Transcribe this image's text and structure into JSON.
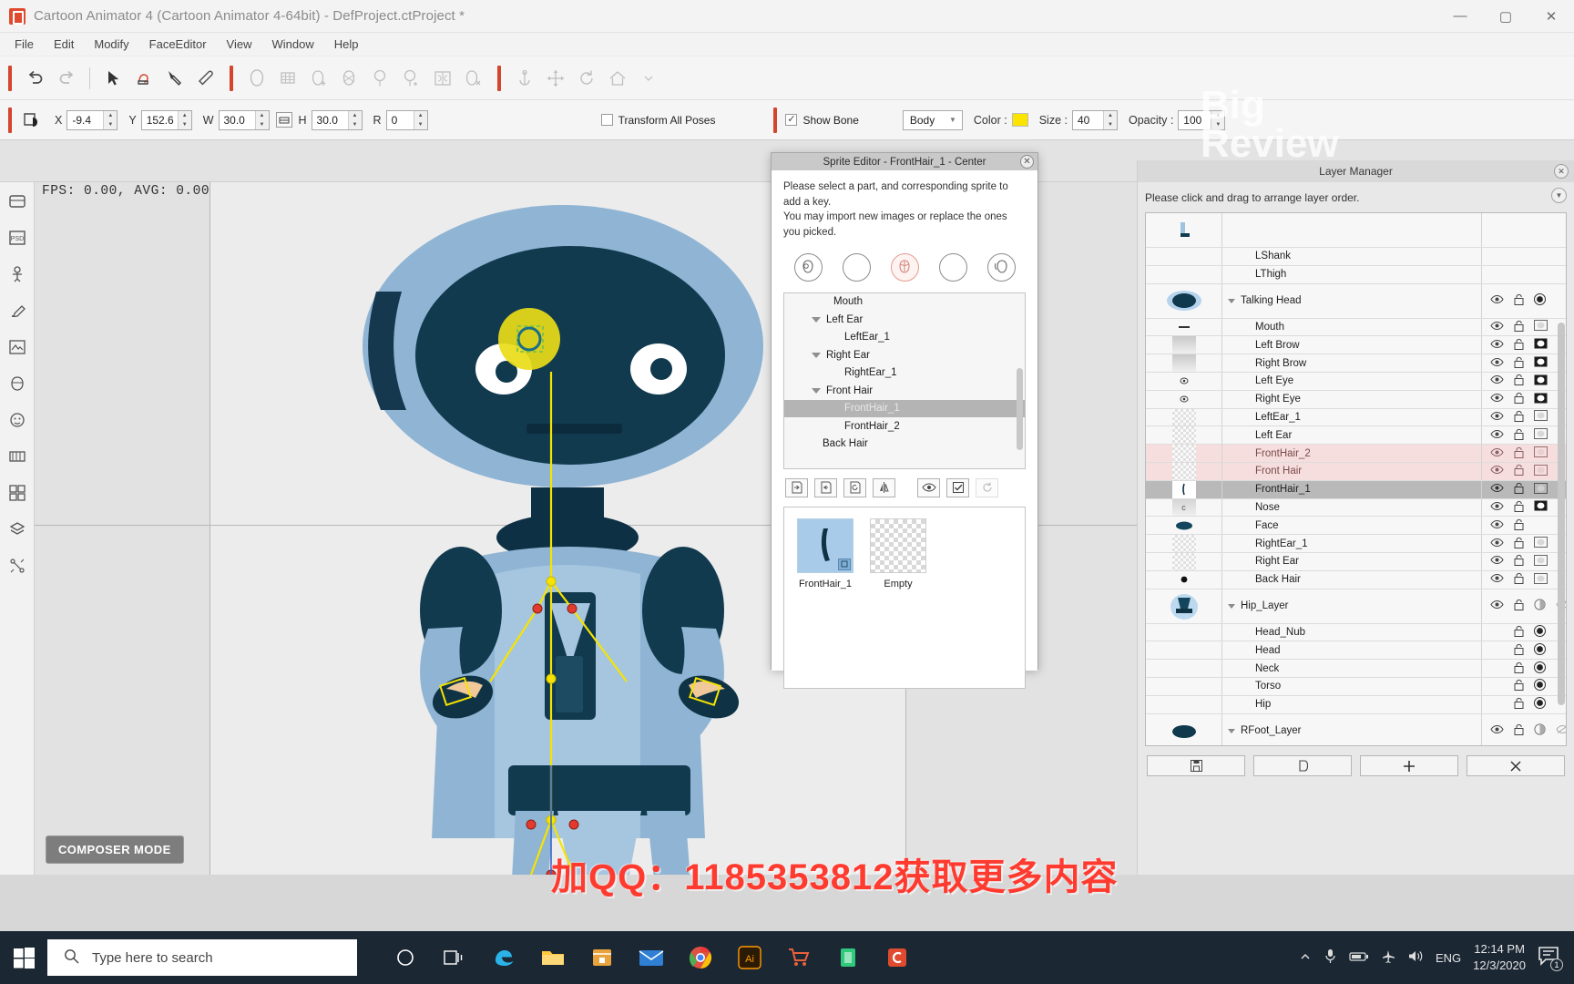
{
  "window": {
    "title": "Cartoon Animator 4  (Cartoon Animator 4-64bit) - DefProject.ctProject *",
    "minimize": "—",
    "maximize": "▢",
    "close": "✕"
  },
  "menu": [
    "File",
    "Edit",
    "Modify",
    "FaceEditor",
    "View",
    "Window",
    "Help"
  ],
  "toolbar": {
    "icons": [
      "undo-icon",
      "redo-icon",
      "select-arrow-icon",
      "hand-sprite-icon",
      "pen-tool-icon",
      "eraser-icon",
      "head-icon",
      "grid-head-icon",
      "head-add-icon",
      "head-bone-icon",
      "head-spring-icon",
      "head-spring-add-icon",
      "mirror-head-icon",
      "head-delete-icon",
      "anchor-icon",
      "move-icon",
      "rotate-icon",
      "home-icon"
    ]
  },
  "properties": {
    "x_label": "X",
    "x_value": "-9.4",
    "y_label": "Y",
    "y_value": "152.6",
    "w_label": "W",
    "w_value": "30.0",
    "h_label": "H",
    "h_value": "30.0",
    "r_label": "R",
    "r_value": "0",
    "link_icon": "link-wh-icon",
    "transform_all_poses": "Transform All Poses",
    "transform_all_poses_checked": false,
    "show_bone": "Show Bone",
    "show_bone_checked": true,
    "bone_mode": "Body",
    "color_label": "Color :",
    "color_value": "#fbe400",
    "size_label": "Size :",
    "size_value": "40",
    "opacity_label": "Opacity :",
    "opacity_value": "100"
  },
  "canvas": {
    "fps_text": "FPS: 0.00, AVG: 0.00",
    "mode_badge": "COMPOSER MODE"
  },
  "sprite_editor": {
    "title": "Sprite Editor - FrontHair_1 - Center",
    "close": "✕",
    "description_line1": "Please select a part, and corresponding sprite to add a key.",
    "description_line2": "You may import new images or replace the ones you picked.",
    "part_icons": [
      "head-pivot-icon",
      "blank-circle-icon",
      "hair-part-icon",
      "blank-circle-icon",
      "head-rotate-icon"
    ],
    "active_part_index": 2,
    "tree": [
      {
        "label": "Mouth",
        "depth": 1,
        "expandable": false,
        "selected": false
      },
      {
        "label": "Left Ear",
        "depth": 0,
        "expandable": true,
        "selected": false
      },
      {
        "label": "LeftEar_1",
        "depth": 2,
        "expandable": false,
        "selected": false
      },
      {
        "label": "Right Ear",
        "depth": 0,
        "expandable": true,
        "selected": false
      },
      {
        "label": "RightEar_1",
        "depth": 2,
        "expandable": false,
        "selected": false
      },
      {
        "label": "Front Hair",
        "depth": 0,
        "expandable": true,
        "selected": false
      },
      {
        "label": "FrontHair_1",
        "depth": 2,
        "expandable": false,
        "selected": true
      },
      {
        "label": "FrontHair_2",
        "depth": 2,
        "expandable": false,
        "selected": false
      },
      {
        "label": "Back Hair",
        "depth": 1,
        "expandable": false,
        "selected": false
      }
    ],
    "tool_icons": [
      "import-image-icon",
      "replace-image-icon",
      "reload-image-icon",
      "mirror-icon",
      "eye-icon",
      "checkbox-icon",
      "refresh-icon"
    ],
    "sprites": [
      {
        "label": "FrontHair_1",
        "selected": true,
        "empty": false
      },
      {
        "label": "Empty",
        "selected": false,
        "empty": true
      }
    ]
  },
  "layer_manager": {
    "title": "Layer Manager",
    "instruction": "Please click and drag to arrange layer order.",
    "collapse_icon": "close-icon",
    "rollup_icon": "chevron-down-icon",
    "rows": [
      {
        "name": "",
        "thumb": "foot",
        "indent": 0,
        "state": "normal",
        "big": true,
        "eye": false,
        "lock": false,
        "mask": "none"
      },
      {
        "name": "LShank",
        "thumb": "none",
        "indent": 2,
        "state": "normal",
        "big": false,
        "eye": false,
        "lock": false,
        "mask": "none"
      },
      {
        "name": "LThigh",
        "thumb": "none",
        "indent": 2,
        "state": "normal",
        "big": false,
        "eye": false,
        "lock": false,
        "mask": "none"
      },
      {
        "name": "Talking Head",
        "thumb": "head",
        "indent": 0,
        "state": "normal",
        "big": true,
        "expandable": true,
        "eye": true,
        "lock": true,
        "mask": "dot"
      },
      {
        "name": "Mouth",
        "thumb": "mouth",
        "indent": 2,
        "state": "normal",
        "big": false,
        "eye": true,
        "lock": true,
        "mask": "light"
      },
      {
        "name": "Left Brow",
        "thumb": "brow",
        "indent": 2,
        "state": "normal",
        "big": false,
        "eye": true,
        "lock": true,
        "mask": "solid"
      },
      {
        "name": "Right Brow",
        "thumb": "brow",
        "indent": 2,
        "state": "normal",
        "big": false,
        "eye": true,
        "lock": true,
        "mask": "solid"
      },
      {
        "name": "Left Eye",
        "thumb": "eye",
        "indent": 2,
        "state": "normal",
        "big": false,
        "eye": true,
        "lock": true,
        "mask": "solid"
      },
      {
        "name": "Right Eye",
        "thumb": "eye",
        "indent": 2,
        "state": "normal",
        "big": false,
        "eye": true,
        "lock": true,
        "mask": "solid"
      },
      {
        "name": "LeftEar_1",
        "thumb": "checker",
        "indent": 2,
        "state": "normal",
        "big": false,
        "eye": true,
        "lock": true,
        "mask": "light"
      },
      {
        "name": "Left Ear",
        "thumb": "checker",
        "indent": 2,
        "state": "normal",
        "big": false,
        "eye": true,
        "lock": true,
        "mask": "light"
      },
      {
        "name": "FrontHair_2",
        "thumb": "checker",
        "indent": 2,
        "state": "pink",
        "big": false,
        "eye": true,
        "lock": true,
        "mask": "light"
      },
      {
        "name": "Front Hair",
        "thumb": "checker",
        "indent": 2,
        "state": "pink",
        "big": false,
        "eye": true,
        "lock": true,
        "mask": "light"
      },
      {
        "name": "FrontHair_1",
        "thumb": "hair",
        "indent": 2,
        "state": "selected",
        "big": false,
        "eye": true,
        "lock": true,
        "mask": "light"
      },
      {
        "name": "Nose",
        "thumb": "nose",
        "indent": 2,
        "state": "normal",
        "big": false,
        "eye": true,
        "lock": true,
        "mask": "solid"
      },
      {
        "name": "Face",
        "thumb": "face",
        "indent": 2,
        "state": "normal",
        "big": false,
        "eye": true,
        "lock": true,
        "mask": "none"
      },
      {
        "name": "RightEar_1",
        "thumb": "checker",
        "indent": 2,
        "state": "normal",
        "big": false,
        "eye": true,
        "lock": true,
        "mask": "light"
      },
      {
        "name": "Right Ear",
        "thumb": "checker",
        "indent": 2,
        "state": "normal",
        "big": false,
        "eye": true,
        "lock": true,
        "mask": "light"
      },
      {
        "name": "Back Hair",
        "thumb": "dot",
        "indent": 2,
        "state": "normal",
        "big": false,
        "eye": true,
        "lock": true,
        "mask": "light"
      },
      {
        "name": "Hip_Layer",
        "thumb": "body",
        "indent": 0,
        "state": "normal",
        "big": true,
        "expandable": true,
        "eye": true,
        "lock": true,
        "mask": "halfdot",
        "extra": "eye-off"
      },
      {
        "name": "Head_Nub",
        "thumb": "none",
        "indent": 2,
        "state": "normal",
        "big": false,
        "eye": false,
        "lock": true,
        "mask": "dot"
      },
      {
        "name": "Head",
        "thumb": "none",
        "indent": 2,
        "state": "normal",
        "big": false,
        "eye": false,
        "lock": true,
        "mask": "dot"
      },
      {
        "name": "Neck",
        "thumb": "none",
        "indent": 2,
        "state": "normal",
        "big": false,
        "eye": false,
        "lock": true,
        "mask": "dot"
      },
      {
        "name": "Torso",
        "thumb": "none",
        "indent": 2,
        "state": "normal",
        "big": false,
        "eye": false,
        "lock": true,
        "mask": "dot"
      },
      {
        "name": "Hip",
        "thumb": "none",
        "indent": 2,
        "state": "normal",
        "big": false,
        "eye": false,
        "lock": true,
        "mask": "dot"
      },
      {
        "name": "RFoot_Layer",
        "thumb": "foot2",
        "indent": 0,
        "state": "normal",
        "big": true,
        "expandable": true,
        "eye": true,
        "lock": true,
        "mask": "halfdot",
        "extra": "eye-off"
      }
    ],
    "footer_buttons": [
      {
        "icon": "save-icon",
        "name": "save-layer-button"
      },
      {
        "icon": "duplicate-icon",
        "name": "duplicate-layer-button"
      },
      {
        "icon": "plus-icon",
        "name": "add-layer-button"
      },
      {
        "icon": "close-icon",
        "name": "delete-layer-button"
      }
    ]
  },
  "watermarks": {
    "big_review_line1": "Big",
    "big_review_line2": "Review",
    "qq": "加QQ：1185353812获取更多内容"
  },
  "taskbar": {
    "start_icon": "windows-logo-icon",
    "search_placeholder": "Type here to search",
    "search_icon": "search-icon",
    "apps": [
      {
        "name": "cortana-icon",
        "glyph": "○",
        "color": "#ffffff"
      },
      {
        "name": "task-view-icon",
        "glyph": "▤",
        "color": "#ffffff"
      },
      {
        "name": "edge-icon",
        "glyph": "e",
        "color": "#2bb3e8"
      },
      {
        "name": "file-explorer-icon",
        "glyph": "▭",
        "color": "#ffc83d"
      },
      {
        "name": "store-icon",
        "glyph": "▤",
        "color": "#e8a33d"
      },
      {
        "name": "mail-icon",
        "glyph": "✉",
        "color": "#2f7fd4"
      },
      {
        "name": "chrome-icon",
        "glyph": "◉",
        "color": "#4285f4"
      },
      {
        "name": "illustrator-icon",
        "glyph": "Ai",
        "color": "#ff9a00"
      },
      {
        "name": "shopping-cart-icon",
        "glyph": "🛒",
        "color": "#e8613c"
      },
      {
        "name": "green-app-icon",
        "glyph": "▮",
        "color": "#2fc97c"
      },
      {
        "name": "cartoon-animator-icon",
        "glyph": "C",
        "color": "#e04a2f"
      }
    ],
    "tray_icons": [
      "up-chevron-icon",
      "microphone-icon",
      "battery-icon",
      "airplane-icon",
      "volume-icon"
    ],
    "language": "ENG",
    "time": "12:14 PM",
    "date": "12/3/2020",
    "notification_count": "1"
  }
}
